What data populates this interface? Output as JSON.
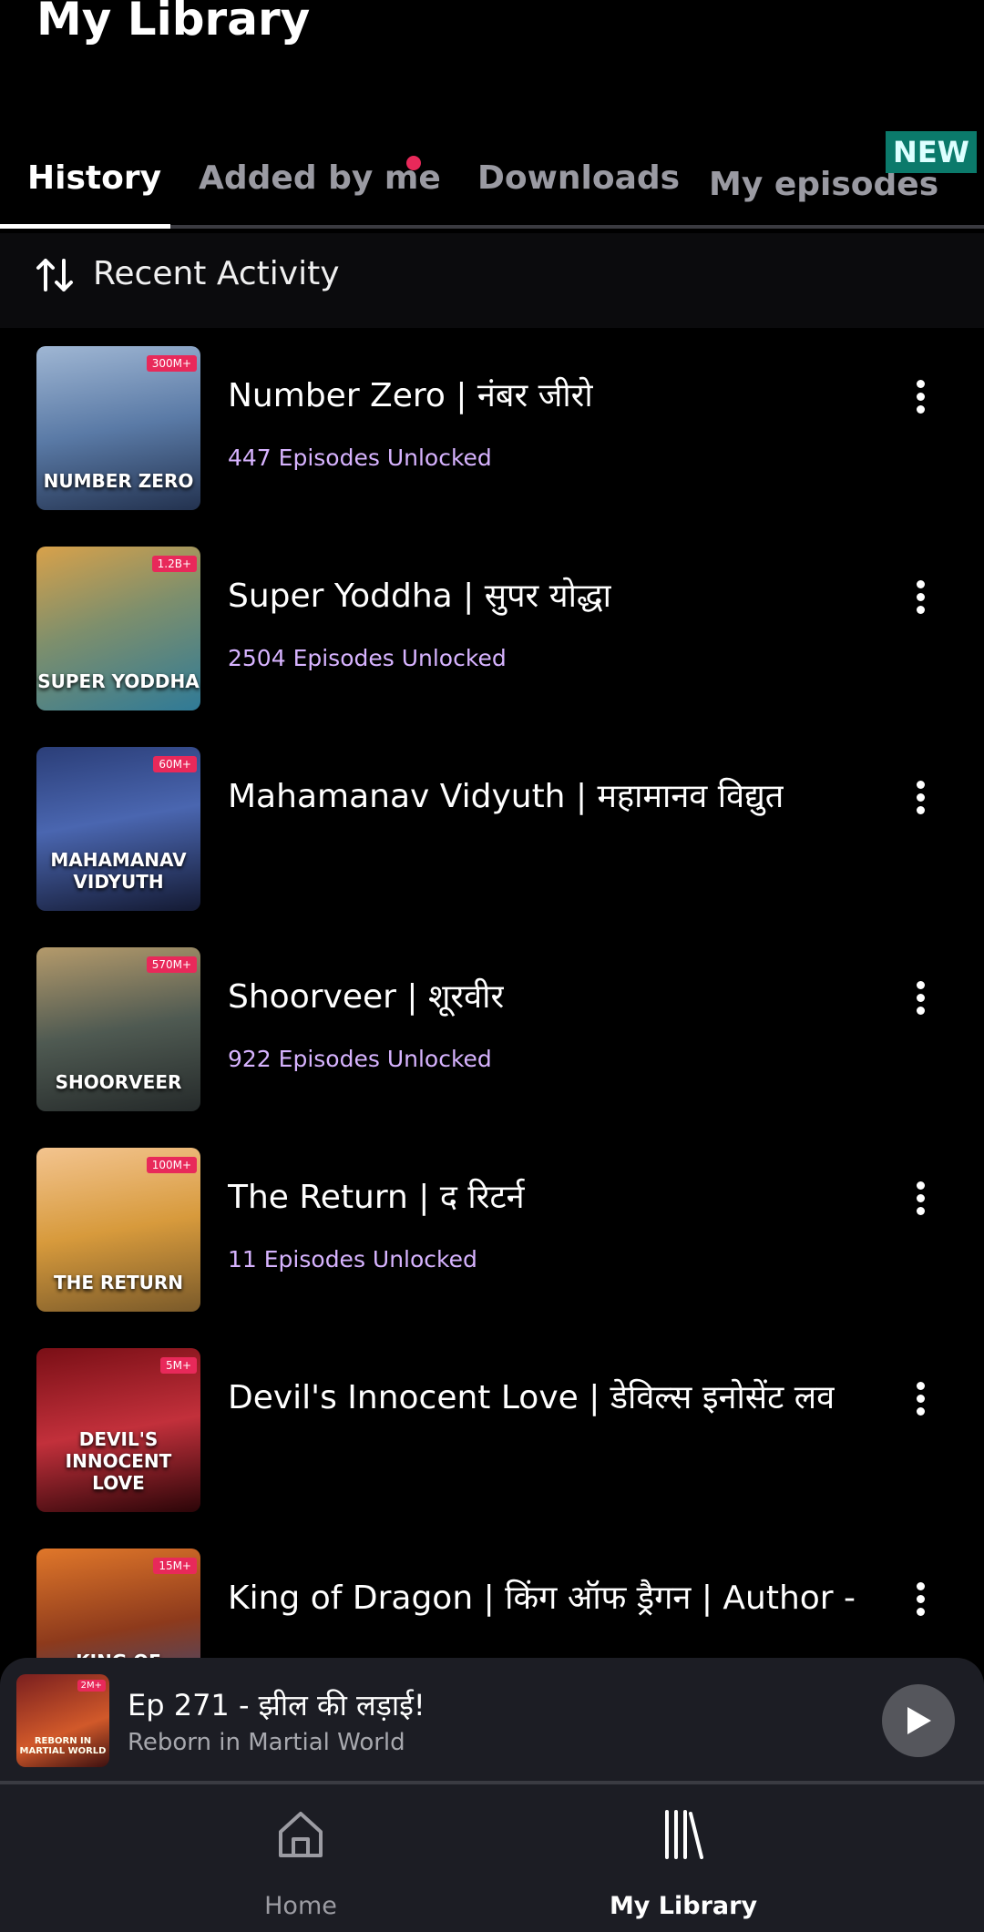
{
  "header": {
    "title": "My Library"
  },
  "tabs": [
    {
      "label": "History",
      "active": true
    },
    {
      "label": "Added by me",
      "has_dot": true
    },
    {
      "label": "Downloads"
    },
    {
      "label": "My episodes",
      "badge": "NEW"
    }
  ],
  "sort": {
    "label": "Recent Activity",
    "icon": "sort-arrows-icon"
  },
  "items": [
    {
      "title": "Number Zero | नंबर जीरो",
      "subtitle": "447 Episodes Unlocked",
      "thumb_text": "NUMBER ZERO",
      "thumb_badge": "300M+"
    },
    {
      "title": "Super Yoddha | सुपर योद्धा",
      "subtitle": "2504 Episodes Unlocked",
      "thumb_text": "SUPER YODDHA",
      "thumb_badge": "1.2B+"
    },
    {
      "title": "Mahamanav Vidyuth | महामानव विद्युत",
      "subtitle": "",
      "thumb_text": "MAHAMANAV VIDYUTH",
      "thumb_badge": "60M+"
    },
    {
      "title": "Shoorveer | शूरवीर",
      "subtitle": "922 Episodes Unlocked",
      "thumb_text": "SHOORVEER",
      "thumb_badge": "570M+"
    },
    {
      "title": "The Return | द रिटर्न",
      "subtitle": "11 Episodes Unlocked",
      "thumb_text": "THE RETURN",
      "thumb_badge": "100M+"
    },
    {
      "title": "Devil's Innocent Love | डेविल्स इनोसेंट लव",
      "subtitle": "",
      "thumb_text": "DEVIL'S INNOCENT LOVE",
      "thumb_badge": "5M+"
    },
    {
      "title": "King of Dragon | किंग ऑफ ड्रैगन | Author -...",
      "subtitle": "",
      "thumb_text": "KING OF DRAGON",
      "thumb_badge": "15M+"
    }
  ],
  "mini_player": {
    "title": "Ep 271 -  झील की लड़ाई!",
    "subtitle": "Reborn in Martial World",
    "thumb_text": "REBORN IN MARTIAL WORLD",
    "thumb_badge": "2M+"
  },
  "bottom_nav": [
    {
      "label": "Home",
      "icon": "home-icon"
    },
    {
      "label": "My Library",
      "icon": "library-icon",
      "active": true
    }
  ],
  "colors": {
    "accent_subtitle": "#d7b3ff",
    "badge_red": "#e8295a",
    "new_badge": "#0b7a6b",
    "background": "#000000",
    "nav_background": "#1c1d24"
  }
}
